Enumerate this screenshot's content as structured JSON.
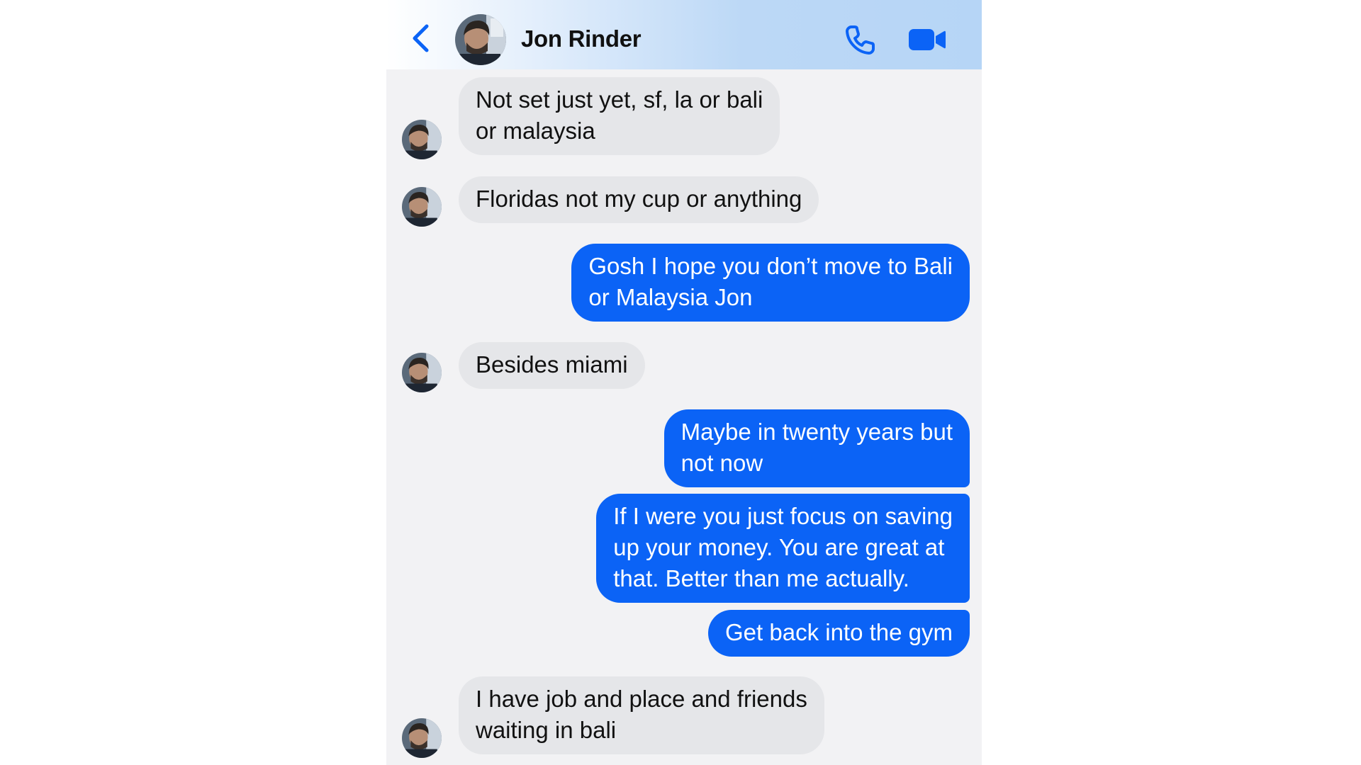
{
  "header": {
    "contact_name": "Jon Rinder",
    "icons": [
      "chevron-left-icon",
      "phone-icon",
      "video-camera-icon"
    ],
    "accent_color": "#0b63f6"
  },
  "messages": [
    {
      "direction": "incoming",
      "lines": [
        "Not set just yet, sf, la or bali",
        "or malaysia"
      ]
    },
    {
      "direction": "incoming",
      "lines": [
        "Floridas not my cup or anything"
      ]
    },
    {
      "direction": "outgoing",
      "lines": [
        "Gosh I hope you don’t move to Bali",
        "or Malaysia Jon"
      ]
    },
    {
      "direction": "incoming",
      "lines": [
        "Besides miami"
      ]
    },
    {
      "direction": "outgoing",
      "lines": [
        "Maybe in twenty years but",
        "not now"
      ]
    },
    {
      "direction": "outgoing",
      "lines": [
        "If I were you just focus on saving",
        "up your money. You are great at",
        "that. Better than me actually."
      ]
    },
    {
      "direction": "outgoing",
      "lines": [
        "Get back into the gym"
      ]
    },
    {
      "direction": "incoming",
      "lines": [
        "I have job and place and friends",
        "waiting in bali"
      ]
    }
  ],
  "colors": {
    "incoming_bubble": "#e5e6e9",
    "outgoing_bubble": "#0b63f6",
    "background": "#f2f2f4"
  }
}
